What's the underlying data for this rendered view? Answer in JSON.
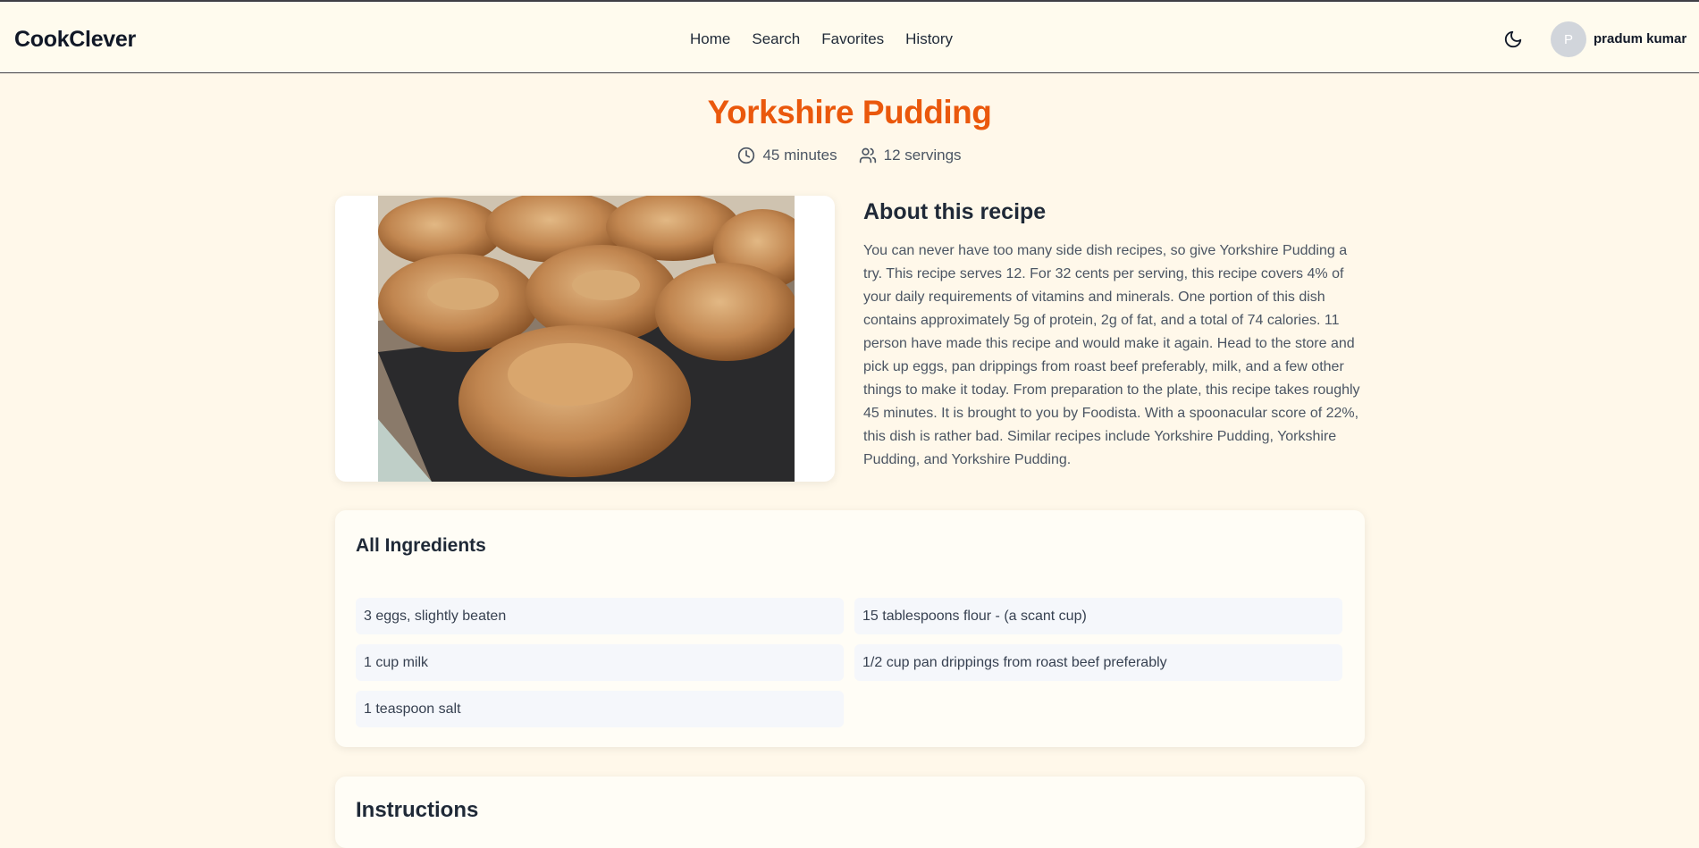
{
  "brand": "CookClever",
  "nav": {
    "items": [
      {
        "label": "Home"
      },
      {
        "label": "Search"
      },
      {
        "label": "Favorites"
      },
      {
        "label": "History"
      }
    ]
  },
  "user": {
    "initial": "P",
    "name": "pradum kumar"
  },
  "icons": {
    "theme": "moon-icon",
    "time": "clock-icon",
    "servings": "users-icon"
  },
  "recipe": {
    "title": "Yorkshire Pudding",
    "time": "45 minutes",
    "servings": "12 servings",
    "about_title": "About this recipe",
    "about_text": "You can never have too many side dish recipes, so give Yorkshire Pudding a try. This recipe serves 12. For 32 cents per serving, this recipe covers 4% of your daily requirements of vitamins and minerals. One portion of this dish contains approximately 5g of protein, 2g of fat, and a total of 74 calories. 11 person have made this recipe and would make it again. Head to the store and pick up eggs, pan drippings from roast beef preferably, milk, and a few other things to make it today. From preparation to the plate, this recipe takes roughly 45 minutes. It is brought to you by Foodista. With a spoonacular score of 22%, this dish is rather bad. Similar recipes include Yorkshire Pudding, Yorkshire Pudding, and Yorkshire Pudding."
  },
  "ingredients": {
    "title": "All Ingredients",
    "items": [
      "3 eggs, slightly beaten",
      "15 tablespoons flour - (a scant cup)",
      "1 cup milk",
      "1/2 cup pan drippings from roast beef preferably",
      "1 teaspoon salt"
    ]
  },
  "instructions": {
    "title": "Instructions"
  },
  "colors": {
    "accent": "#ea580c",
    "background": "#fff8ea"
  }
}
